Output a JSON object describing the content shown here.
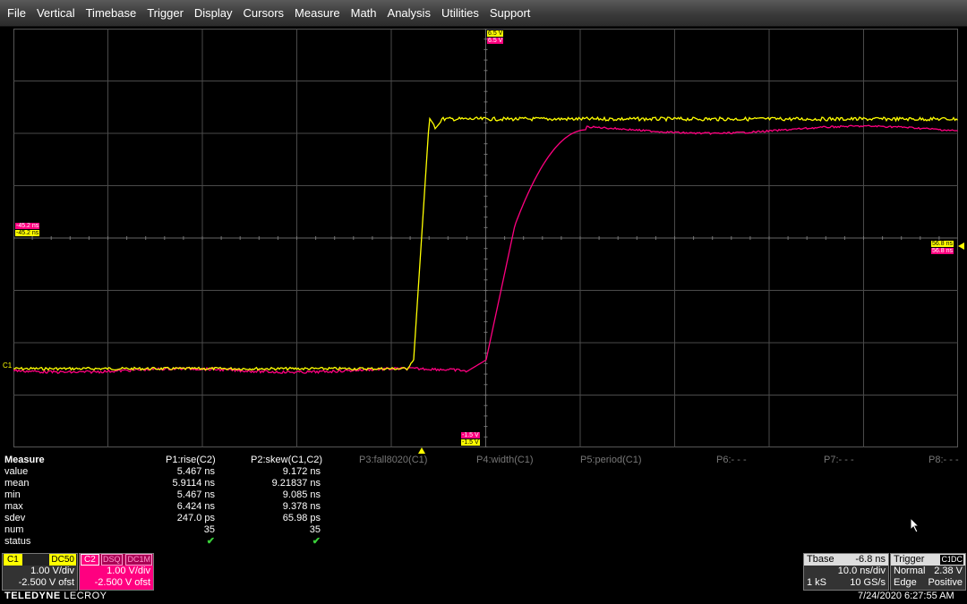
{
  "menu": [
    "File",
    "Vertical",
    "Timebase",
    "Trigger",
    "Display",
    "Cursors",
    "Measure",
    "Math",
    "Analysis",
    "Utilities",
    "Support"
  ],
  "tags": {
    "top_c1": "6.5 V",
    "top_c2": "6.5 V",
    "left_c2": "-45.2 ns",
    "left_c1": "-45.2 ns",
    "right_c1": "56.8 ns",
    "right_c2": "56.8 ns",
    "bottom_c2": "-1.5 V",
    "bottom_c1": "-1.5 V",
    "c1_marker": "C1"
  },
  "measure": {
    "title": "Measure",
    "row_labels": [
      "value",
      "mean",
      "min",
      "max",
      "sdev",
      "num",
      "status"
    ],
    "params": [
      {
        "label": "P1:rise(C2)",
        "active": true,
        "values": [
          "5.467 ns",
          "5.9114 ns",
          "5.467 ns",
          "6.424 ns",
          "247.0 ps",
          "35"
        ]
      },
      {
        "label": "P2:skew(C1,C2)",
        "active": true,
        "values": [
          "9.172 ns",
          "9.21837 ns",
          "9.085 ns",
          "9.378 ns",
          "65.98 ps",
          "35"
        ]
      },
      {
        "label": "P3:fall8020(C1)",
        "active": false
      },
      {
        "label": "P4:width(C1)",
        "active": false
      },
      {
        "label": "P5:period(C1)",
        "active": false
      },
      {
        "label": "P6:- - -",
        "active": false
      },
      {
        "label": "P7:- - -",
        "active": false
      },
      {
        "label": "P8:- - -",
        "active": false
      }
    ],
    "status_glyph": "✔"
  },
  "channels": {
    "c1": {
      "id": "C1",
      "coupling": "DC50",
      "vdiv": "1.00 V/div",
      "offset": "-2.500 V ofst"
    },
    "c2": {
      "id": "C2",
      "bw": "DSQ",
      "coupling": "DC1M",
      "vdiv": "1.00 V/div",
      "offset": "-2.500 V ofst"
    }
  },
  "brand": {
    "a": "TELEDYNE",
    "b": "LECROY"
  },
  "timebase": {
    "title": "Tbase",
    "delay": "-6.8 ns",
    "tdiv": "10.0 ns/div",
    "points": "1 kS",
    "rate": "10 GS/s"
  },
  "trigger": {
    "title": "Trigger",
    "source": "C1",
    "coupling": "DC",
    "mode": "Normal",
    "level": "2.38 V",
    "type": "Edge",
    "slope": "Positive"
  },
  "datetime": "7/24/2020 6:27:55 AM",
  "colors": {
    "c1": "#ffff00",
    "c2": "#ff0080",
    "grid": "#4a4a4a"
  }
}
